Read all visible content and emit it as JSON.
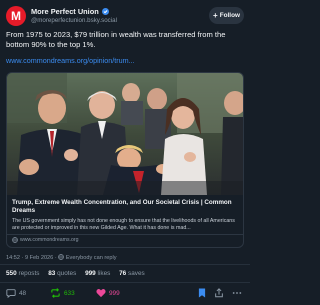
{
  "author": {
    "name": "More Perfect Union",
    "handle": "@moreperfectunion.bsky.social",
    "avatar_glyph": "M",
    "verified_color": "#3b8cf0"
  },
  "follow_label": "Follow",
  "post": {
    "text": "From 1975 to 2023, $79 trillion in wealth was transferred from the bottom 90% to the top 1%.",
    "link": "www.commondreams.org/opinion/trum..."
  },
  "card": {
    "title": "Trump, Extreme Wealth Concentration, and Our Societal Crisis | Common Dreams",
    "description": "The US government simply has not done enough to ensure that the livelihoods of all Americans are protected or improved in this new Gilded Age. What it has done is mad...",
    "domain": "www.commondreams.org"
  },
  "meta": {
    "timestamp": "14:52 · 9 Feb 2026",
    "audience": "Everybody can reply"
  },
  "stats": {
    "reposts_count": "550",
    "reposts_label": "reposts",
    "quotes_count": "83",
    "quotes_label": "quotes",
    "likes_count": "999",
    "likes_label": "likes",
    "saves_count": "76",
    "saves_label": "saves"
  },
  "actions": {
    "reply_count": "48",
    "repost_count": "633",
    "like_count": "999"
  },
  "colors": {
    "background": "#161e27",
    "accent": "#3b8cf0",
    "repost_active": "#20bc07",
    "like_active": "#ec4899",
    "brand_red": "#e61b29"
  }
}
